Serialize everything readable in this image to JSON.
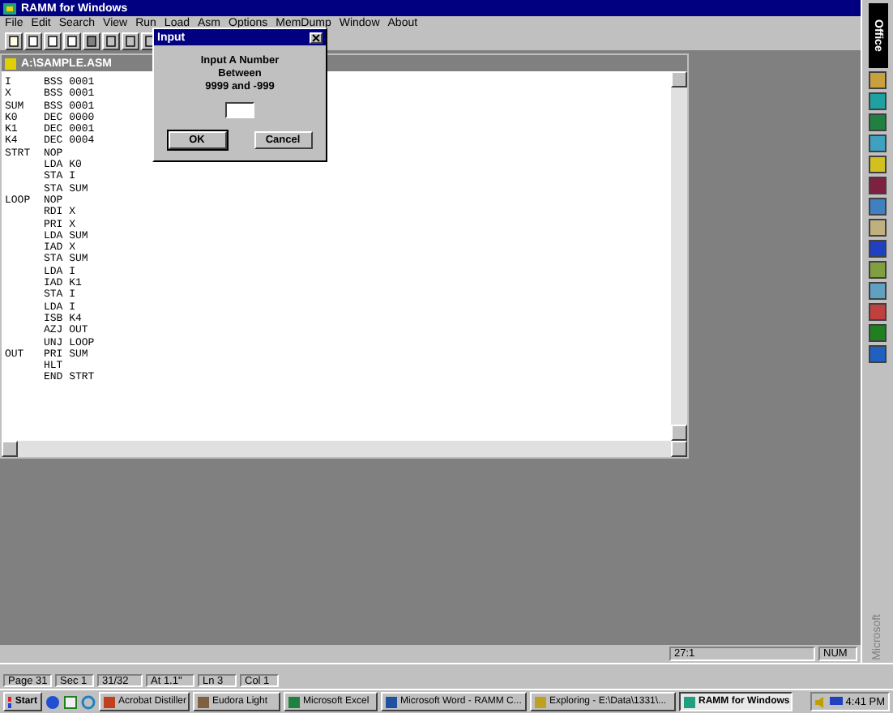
{
  "window": {
    "title": "RAMM for Windows"
  },
  "menu": [
    "File",
    "Edit",
    "Search",
    "View",
    "Run",
    "Load",
    "Asm",
    "Options",
    "MemDump",
    "Window",
    "About"
  ],
  "document": {
    "title": "A:\\SAMPLE.ASM",
    "lines": [
      {
        "label": "I",
        "code": "BSS 0001"
      },
      {
        "label": "X",
        "code": "BSS 0001"
      },
      {
        "label": "SUM",
        "code": "BSS 0001"
      },
      {
        "label": "K0",
        "code": "DEC 0000"
      },
      {
        "label": "K1",
        "code": "DEC 0001"
      },
      {
        "label": "K4",
        "code": "DEC 0004"
      },
      {
        "label": "STRT",
        "code": "NOP"
      },
      {
        "code": "LDA K0"
      },
      {
        "code": "STA I"
      },
      {
        "code": "STA SUM"
      },
      {
        "label": "LOOP",
        "code": "NOP"
      },
      {
        "code": "RDI X"
      },
      {
        "code": "PRI X"
      },
      {
        "code": "LDA SUM"
      },
      {
        "code": "IAD X"
      },
      {
        "code": "STA SUM"
      },
      {
        "code": "LDA I"
      },
      {
        "code": "IAD K1"
      },
      {
        "code": "STA I"
      },
      {
        "code": "LDA I"
      },
      {
        "code": "ISB K4"
      },
      {
        "code": "AZJ OUT"
      },
      {
        "code": "UNJ LOOP"
      },
      {
        "label": "OUT",
        "code": "PRI SUM"
      },
      {
        "code": "HLT"
      },
      {
        "code": "END STRT"
      }
    ]
  },
  "dialog": {
    "title": "Input",
    "prompt": [
      "Input A Number",
      "Between",
      "9999 and -999"
    ],
    "buttons": [
      {
        "label": "OK",
        "default": true
      },
      {
        "label": "Cancel",
        "default": false
      }
    ]
  },
  "status_bar": {
    "position": "27:1",
    "num": "NUM"
  },
  "word_status": [
    "Page 31",
    "Sec 1",
    "31/32",
    "At 1.1\"",
    "Ln 3",
    "Col 1"
  ],
  "taskbar": {
    "start": "Start",
    "tasks": [
      {
        "label": "Acrobat Distiller",
        "selected": false
      },
      {
        "label": "Eudora Light",
        "selected": false
      },
      {
        "label": "Microsoft Excel",
        "selected": false
      },
      {
        "label": "Microsoft Word - RAMM C...",
        "selected": false
      },
      {
        "label": "Exploring - E:\\Data\\1331\\...",
        "selected": false
      },
      {
        "label": "RAMM for Windows",
        "selected": true
      }
    ],
    "clock": "4:41 PM"
  },
  "office_bar": {
    "title": "Office",
    "footer": "Microsoft"
  }
}
